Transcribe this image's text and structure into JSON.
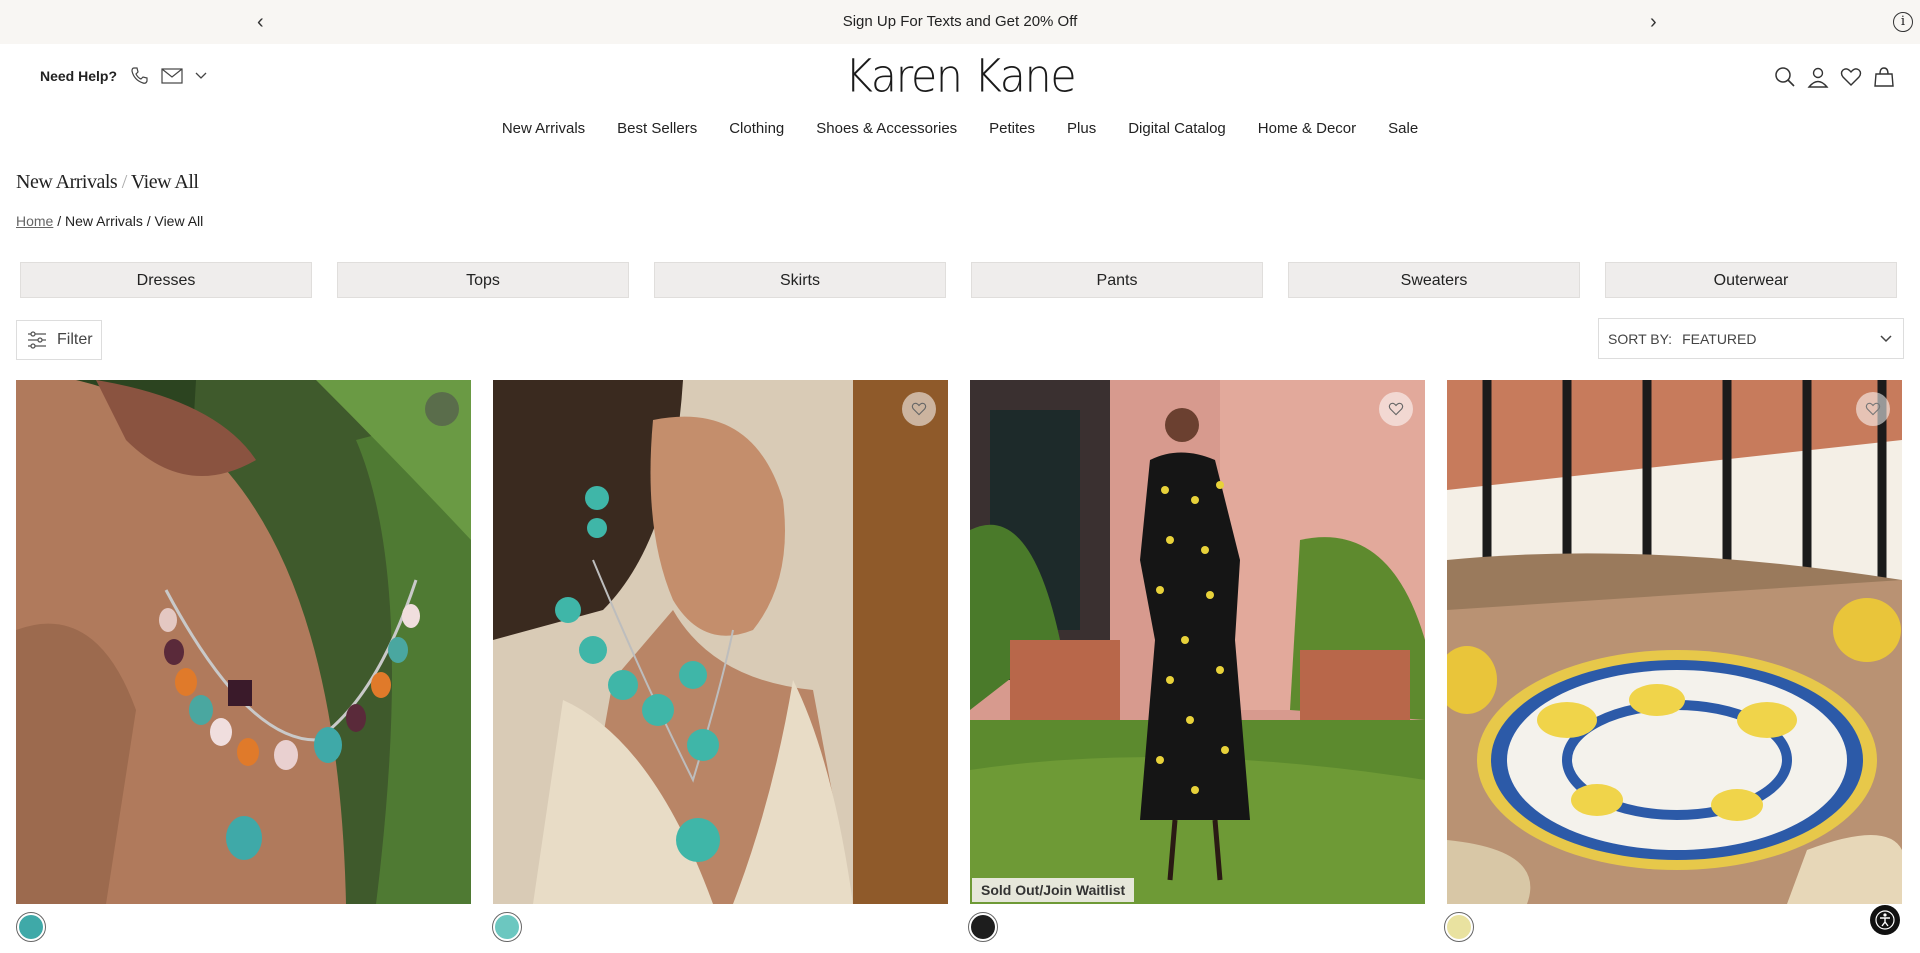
{
  "announcement": {
    "text": "Sign Up For Texts and Get 20% Off",
    "prev": "‹",
    "next": "›",
    "info": "i"
  },
  "header": {
    "help_label": "Need Help?",
    "logo": "Karen Kane"
  },
  "nav": {
    "items": [
      "New Arrivals",
      "Best Sellers",
      "Clothing",
      "Shoes & Accessories",
      "Petites",
      "Plus",
      "Digital Catalog",
      "Home & Decor",
      "Sale"
    ]
  },
  "page": {
    "title_main": "New Arrivals",
    "title_sep": "/",
    "title_sub": "View All",
    "breadcrumb_home": "Home",
    "breadcrumb_rest": " / New Arrivals / View All"
  },
  "categories": [
    "Dresses",
    "Tops",
    "Skirts",
    "Pants",
    "Sweaters",
    "Outerwear"
  ],
  "toolbar": {
    "filter_label": "Filter",
    "sort_label": "SORT BY:",
    "sort_value": "FEATURED"
  },
  "products": [
    {
      "swatch_color": "#3fa9a8"
    },
    {
      "swatch_color": "#6cc7c0"
    },
    {
      "swatch_color": "#1d1d1d",
      "badge": "Sold Out/Join Waitlist"
    },
    {
      "swatch_color": "#e9e2a0"
    }
  ],
  "colors": {
    "announcement_bg": "#f8f6f3",
    "category_bg": "#efedec"
  }
}
